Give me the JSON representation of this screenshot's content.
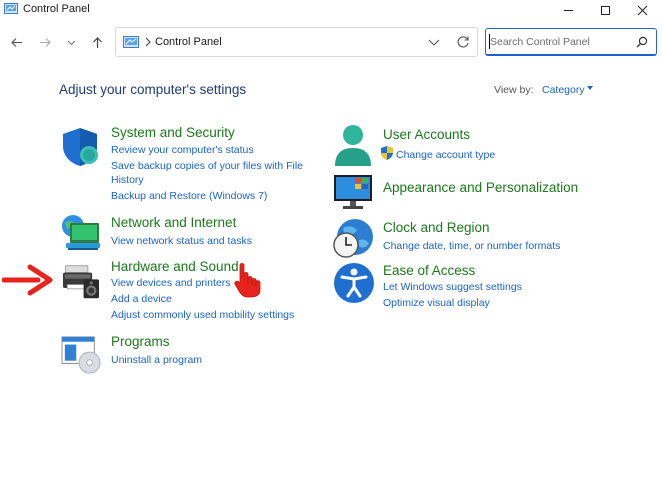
{
  "window": {
    "title": "Control Panel",
    "icon": "control-panel-icon",
    "buttons": [
      "minimize",
      "maximize",
      "close"
    ]
  },
  "address_bar": {
    "location": "Control Panel",
    "search_placeholder": "Search Control Panel"
  },
  "header": {
    "heading": "Adjust your computer's settings",
    "view_by_label": "View by:",
    "view_by_value": "Category"
  },
  "categories": [
    {
      "title": "System and Security",
      "icon": "shield-icon",
      "links": [
        "Review your computer's status",
        "Save backup copies of your files with File",
        "History",
        "Backup and Restore (Windows 7)"
      ]
    },
    {
      "title": "Network and Internet",
      "icon": "network-globe-icon",
      "links": [
        "View network status and tasks"
      ]
    },
    {
      "title": "Hardware and Sound",
      "icon": "printer-speaker-icon",
      "links": [
        "View devices and printers",
        "Add a device",
        "Adjust commonly used mobility settings"
      ]
    },
    {
      "title": "Programs",
      "icon": "programs-disc-icon",
      "links": [
        "Uninstall a program"
      ]
    },
    {
      "title": "User Accounts",
      "icon": "user-icon",
      "links": [
        "Change account type"
      ],
      "link_badge": "uac-shield-icon"
    },
    {
      "title": "Appearance and Personalization",
      "icon": "monitor-icon",
      "links": []
    },
    {
      "title": "Clock and Region",
      "icon": "clock-globe-icon",
      "links": [
        "Change date, time, or number formats"
      ]
    },
    {
      "title": "Ease of Access",
      "icon": "accessibility-icon",
      "links": [
        "Let Windows suggest settings",
        "Optimize visual display"
      ]
    }
  ],
  "annotations": {
    "arrow_color": "#e8231e",
    "hand_color": "#e8231e"
  },
  "colors": {
    "heading": "#1e3a78",
    "category_title": "#1a7a1a",
    "link": "#1a64c8",
    "search_border": "#2a66c8"
  }
}
